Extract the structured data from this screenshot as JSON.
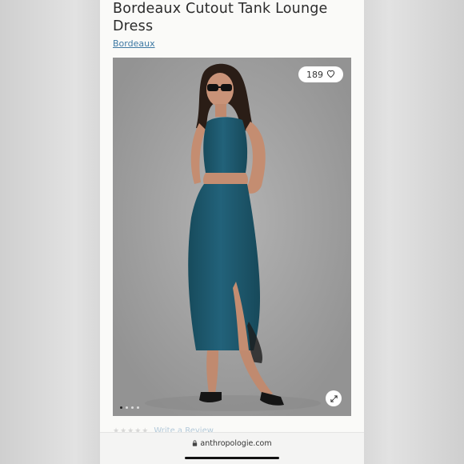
{
  "product": {
    "title": "Bordeaux Cutout Tank Lounge Dress",
    "color_link": "Bordeaux"
  },
  "gallery": {
    "favorite_count": "189",
    "favorite_icon": "heart-icon",
    "expand_icon": "expand-icon",
    "image_count": 4,
    "active_index": 0
  },
  "reviews": {
    "stars": "★★★★★",
    "write_review_label": "Write a Review"
  },
  "browser": {
    "url": "anthropologie.com",
    "lock_icon": "lock-icon"
  },
  "colors": {
    "dress": "#1f5a6e",
    "link": "#3d78a3",
    "background": "#a0a0a0"
  }
}
